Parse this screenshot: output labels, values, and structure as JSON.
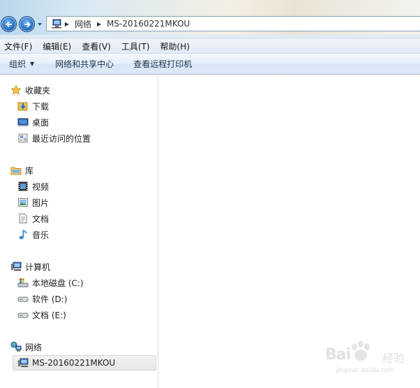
{
  "address_bar": {
    "crumbs": [
      "网络",
      "MS-20160221MKOU"
    ]
  },
  "menu": {
    "items": [
      "文件(F)",
      "编辑(E)",
      "查看(V)",
      "工具(T)",
      "帮助(H)"
    ]
  },
  "toolbar": {
    "organize": "组织",
    "network_center": "网络和共享中心",
    "remote_printers": "查看远程打印机"
  },
  "nav": {
    "favorites": {
      "label": "收藏夹",
      "items": [
        "下载",
        "桌面",
        "最近访问的位置"
      ]
    },
    "libraries": {
      "label": "库",
      "items": [
        "视频",
        "图片",
        "文档",
        "音乐"
      ]
    },
    "computer": {
      "label": "计算机",
      "items": [
        "本地磁盘 (C:)",
        "软件 (D:)",
        "文档 (E:)"
      ]
    },
    "network": {
      "label": "网络",
      "items": [
        "MS-20160221MKOU"
      ]
    }
  },
  "watermark": {
    "brand": "Bai",
    "brand_cn": "经验",
    "url": "jingyan.baidu.com"
  },
  "icons": {
    "back": "back-arrow-icon",
    "forward": "forward-arrow-icon",
    "star": "star-icon",
    "folder": "folder-icon",
    "computer": "computer-icon",
    "network": "network-icon"
  }
}
